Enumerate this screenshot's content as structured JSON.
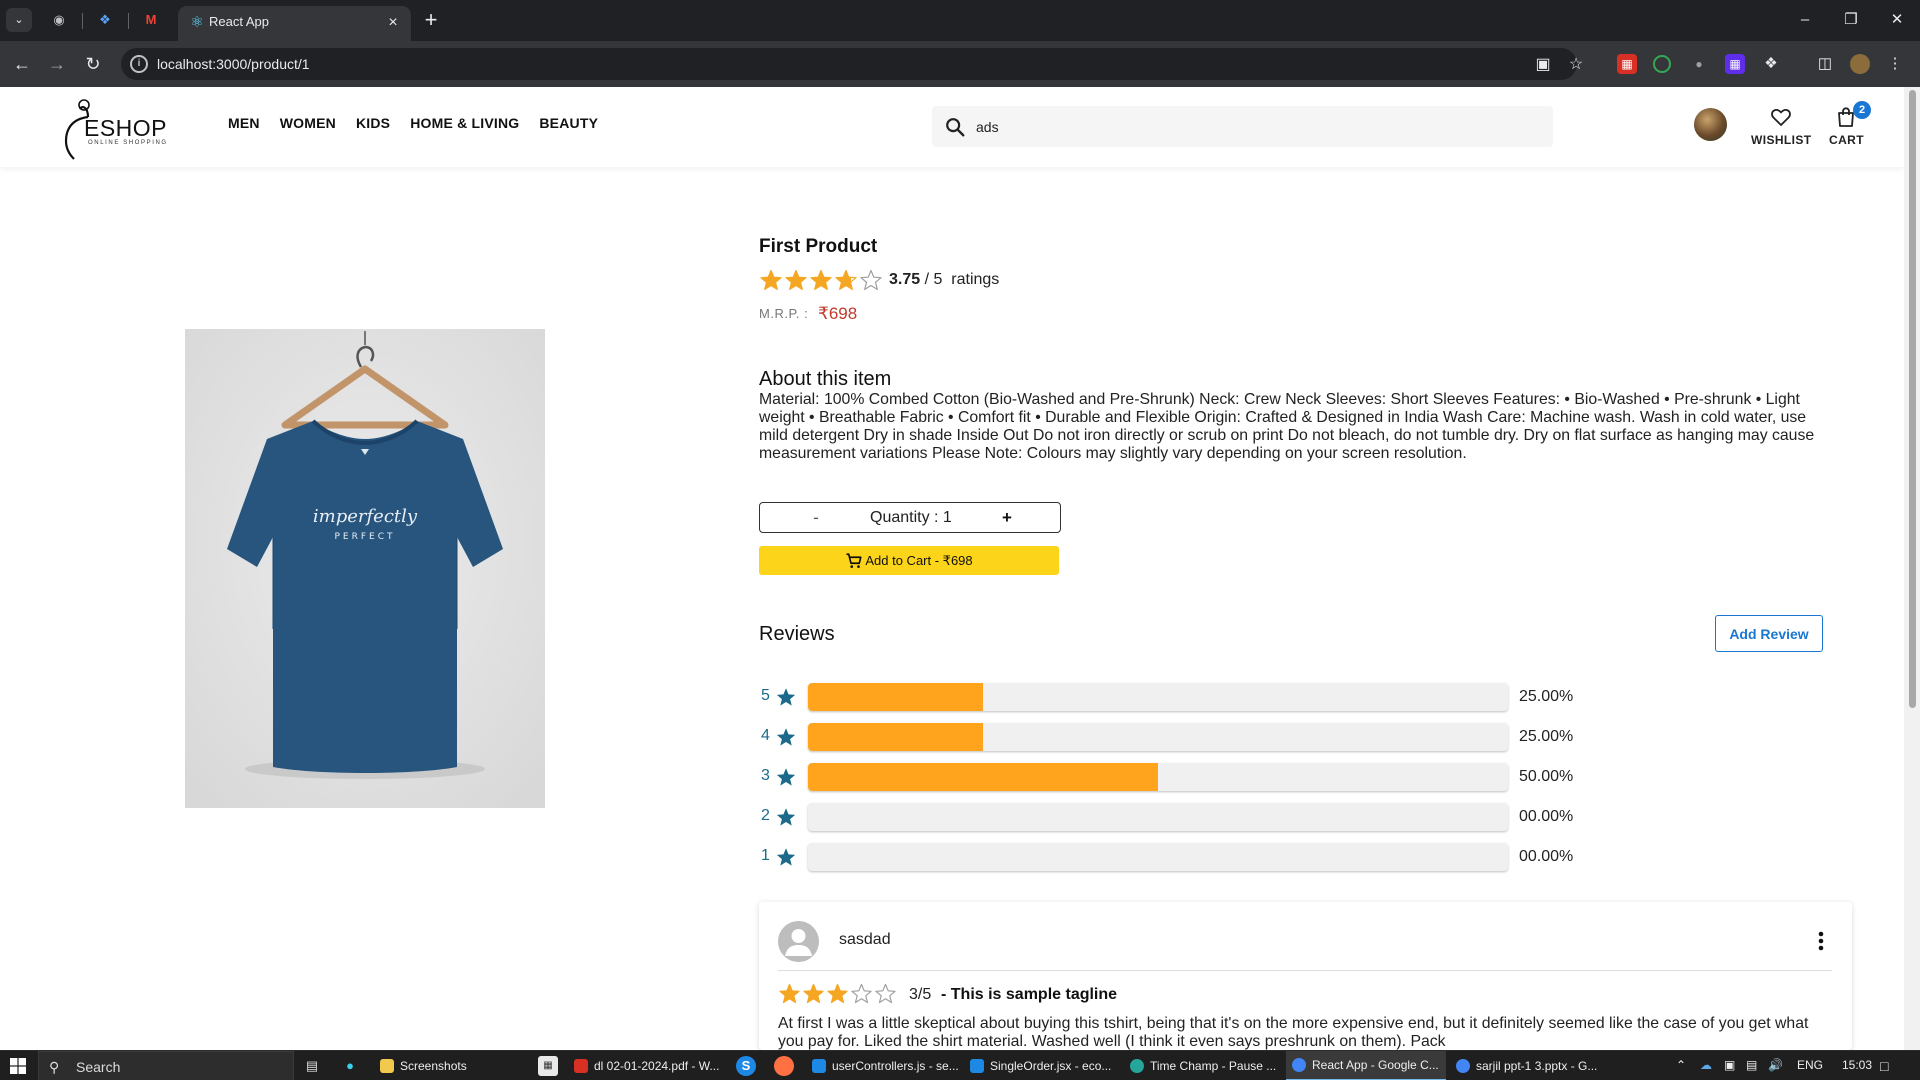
{
  "browser": {
    "active_tab_title": "React App",
    "url": "localhost:3000/product/1",
    "nav": {
      "back_icon": "back-arrow-icon",
      "forward_icon": "forward-arrow-icon",
      "reload_icon": "reload-icon"
    }
  },
  "header": {
    "logo_text": "ESHOP",
    "logo_sub": "ONLINE SHOPPING",
    "nav_items": [
      "MEN",
      "WOMEN",
      "KIDS",
      "HOME & LIVING",
      "BEAUTY"
    ],
    "search_value": "ads",
    "wishlist_label": "WISHLIST",
    "cart_label": "CART",
    "cart_count": "2"
  },
  "product": {
    "title": "First Product",
    "rating_value": "3.75",
    "rating_max": "/ 5",
    "ratings_label": "ratings",
    "rating_stars": 3.75,
    "mrp_label": "M.R.P. :",
    "price": "₹698",
    "image_print_line1": "imperfectly",
    "image_print_line2": "PERFECT",
    "about_title": "About this item",
    "about_text": "Material: 100% Combed Cotton (Bio-Washed and Pre-Shrunk) Neck: Crew Neck Sleeves: Short Sleeves Features: • Bio-Washed • Pre-shrunk • Light weight • Breathable Fabric • Comfort fit • Durable and Flexible Origin: Crafted & Designed in India Wash Care: Machine wash. Wash in cold water, use mild detergent Dry in shade Inside Out Do not iron directly or scrub on print Do not bleach, do not tumble dry. Dry on flat surface as hanging may cause measurement variations Please Note: Colours may slightly vary depending on your screen resolution.",
    "quantity_minus": "-",
    "quantity_text": "Quantity : 1",
    "quantity_plus": "+",
    "add_to_cart_label": "Add to Cart - ₹698"
  },
  "reviews": {
    "title": "Reviews",
    "add_review_label": "Add Review",
    "distribution": [
      {
        "star": "5",
        "percent_label": "25.00%",
        "fraction": 0.25
      },
      {
        "star": "4",
        "percent_label": "25.00%",
        "fraction": 0.25
      },
      {
        "star": "3",
        "percent_label": "50.00%",
        "fraction": 0.5
      },
      {
        "star": "2",
        "percent_label": "00.00%",
        "fraction": 0
      },
      {
        "star": "1",
        "percent_label": "00.00%",
        "fraction": 0
      }
    ],
    "items": [
      {
        "user": "sasdad",
        "stars": 3,
        "score": "3/5",
        "tagline": "- This is sample tagline",
        "body": "At first I was a little skeptical about buying this tshirt, being that it's on the more expensive end, but it definitely seemed like the case of you get what you pay for. Liked the shirt material. Washed well (I think it even says preshrunk on them). Pack"
      }
    ]
  },
  "colors": {
    "star_gold": "#f5a623",
    "bar_fill": "#ffa41c",
    "star_teal": "#1c6a8a",
    "price_red": "#c0392b",
    "add_cart_yellow": "#fcd419",
    "link_blue": "#1976d2"
  },
  "taskbar": {
    "search_label": "Search",
    "apps": [
      "Screenshots",
      "dl 02-01-2024.pdf - W...",
      "userControllers.js - se...",
      "SingleOrder.jsx - eco...",
      "Time Champ - Pause ...",
      "React App - Google C...",
      "sarjil ppt-1 3.pptx - G..."
    ],
    "lang": "ENG",
    "time": "15:03"
  }
}
